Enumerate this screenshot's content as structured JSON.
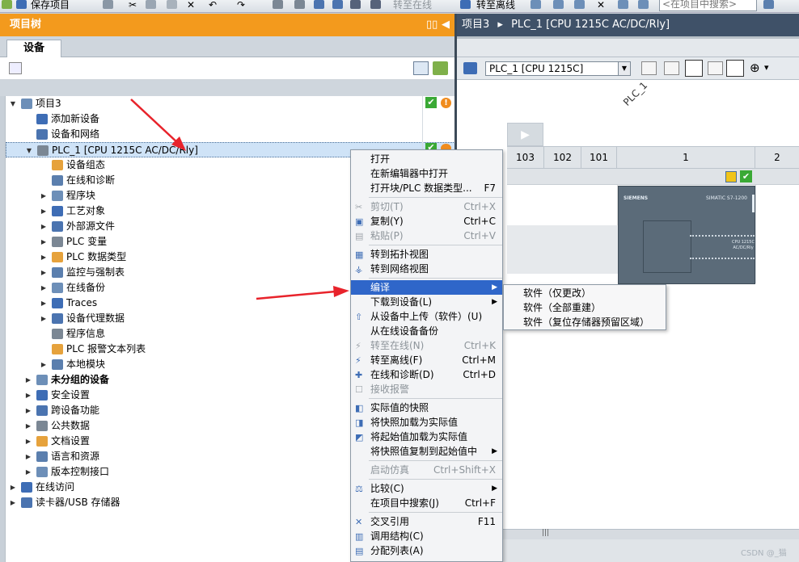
{
  "toolbar": {
    "save_label": "保存项目",
    "go_online_label": "转至在线",
    "go_offline_label": "转至离线",
    "search_placeholder": "<在项目中搜索>"
  },
  "tree_panel": {
    "title": "项目树",
    "devices_tab": "设备"
  },
  "tree": {
    "items": [
      {
        "label": "项目3",
        "level": 0,
        "expanded": true
      },
      {
        "label": "添加新设备",
        "level": 1
      },
      {
        "label": "设备和网络",
        "level": 1
      },
      {
        "label": "PLC_1 [CPU 1215C AC/DC/Rly]",
        "level": 1,
        "expanded": true,
        "selected": true
      },
      {
        "label": "设备组态",
        "level": 2
      },
      {
        "label": "在线和诊断",
        "level": 2
      },
      {
        "label": "程序块",
        "level": 2,
        "collapsed": true
      },
      {
        "label": "工艺对象",
        "level": 2,
        "collapsed": true
      },
      {
        "label": "外部源文件",
        "level": 2,
        "collapsed": true
      },
      {
        "label": "PLC 变量",
        "level": 2,
        "collapsed": true
      },
      {
        "label": "PLC 数据类型",
        "level": 2,
        "collapsed": true
      },
      {
        "label": "监控与强制表",
        "level": 2,
        "collapsed": true
      },
      {
        "label": "在线备份",
        "level": 2,
        "collapsed": true
      },
      {
        "label": "Traces",
        "level": 2,
        "collapsed": true
      },
      {
        "label": "设备代理数据",
        "level": 2,
        "collapsed": true
      },
      {
        "label": "程序信息",
        "level": 2
      },
      {
        "label": "PLC 报警文本列表",
        "level": 2
      },
      {
        "label": "本地模块",
        "level": 2,
        "collapsed": true
      },
      {
        "label": "未分组的设备",
        "level": 1,
        "collapsed": true,
        "bold": true
      },
      {
        "label": "安全设置",
        "level": 1,
        "collapsed": true
      },
      {
        "label": "跨设备功能",
        "level": 1,
        "collapsed": true
      },
      {
        "label": "公共数据",
        "level": 1,
        "collapsed": true
      },
      {
        "label": "文档设置",
        "level": 1,
        "collapsed": true
      },
      {
        "label": "语言和资源",
        "level": 1,
        "collapsed": true
      },
      {
        "label": "版本控制接口",
        "level": 1,
        "collapsed": true
      },
      {
        "label": "在线访问",
        "level": 0,
        "collapsed": true
      },
      {
        "label": "读卡器/USB 存储器",
        "level": 0,
        "collapsed": true
      }
    ]
  },
  "editor": {
    "breadcrumb_project": "项目3",
    "breadcrumb_arrow": "▸",
    "breadcrumb_device": "PLC_1 [CPU 1215C AC/DC/Rly]",
    "device_select": "PLC_1 [CPU 1215C]",
    "station_label": "PLC_1",
    "slots": [
      "103",
      "102",
      "101",
      "1",
      "2"
    ],
    "cpu_brand": "SIEMENS",
    "cpu_model": "SIMATIC S7-1200",
    "cpu_type": "CPU 1215C AC/DC/Rly",
    "scroll_grip": "|||"
  },
  "context_menu": {
    "items": [
      {
        "label": "打开",
        "type": "item"
      },
      {
        "label": "在新编辑器中打开",
        "type": "item"
      },
      {
        "label": "打开块/PLC 数据类型...",
        "shortcut": "F7",
        "type": "item"
      },
      {
        "type": "sep"
      },
      {
        "label": "剪切(T)",
        "shortcut": "Ctrl+X",
        "type": "item",
        "disabled": true,
        "icon": "scissors-icon"
      },
      {
        "label": "复制(Y)",
        "shortcut": "Ctrl+C",
        "type": "item",
        "icon": "copy-icon"
      },
      {
        "label": "粘贴(P)",
        "shortcut": "Ctrl+V",
        "type": "item",
        "disabled": true,
        "icon": "paste-icon"
      },
      {
        "type": "sep"
      },
      {
        "label": "转到拓扑视图",
        "type": "item",
        "icon": "topology-icon"
      },
      {
        "label": "转到网络视图",
        "type": "item",
        "icon": "network-icon"
      },
      {
        "type": "sep"
      },
      {
        "label": "编译",
        "type": "item",
        "submenu": true,
        "highlighted": true
      },
      {
        "label": "下载到设备(L)",
        "type": "item",
        "submenu": true
      },
      {
        "label": "从设备中上传（软件）(U)",
        "type": "item",
        "icon": "upload-icon"
      },
      {
        "label": "从在线设备备份",
        "type": "item"
      },
      {
        "label": "转至在线(N)",
        "shortcut": "Ctrl+K",
        "type": "item",
        "disabled": true,
        "icon": "go-online-icon"
      },
      {
        "label": "转至离线(F)",
        "shortcut": "Ctrl+M",
        "type": "item",
        "icon": "go-offline-icon"
      },
      {
        "label": "在线和诊断(D)",
        "shortcut": "Ctrl+D",
        "type": "item",
        "icon": "diagnostics-icon"
      },
      {
        "label": "接收报警",
        "type": "item",
        "disabled": true,
        "icon": "checkbox-icon"
      },
      {
        "type": "sep"
      },
      {
        "label": "实际值的快照",
        "type": "item",
        "icon": "snapshot-icon"
      },
      {
        "label": "将快照加载为实际值",
        "type": "item",
        "icon": "load-snapshot-icon"
      },
      {
        "label": "将起始值加载为实际值",
        "type": "item",
        "icon": "load-start-icon"
      },
      {
        "label": "将快照值复制到起始值中",
        "type": "item",
        "submenu": true
      },
      {
        "type": "sep"
      },
      {
        "label": "启动仿真",
        "shortcut": "Ctrl+Shift+X",
        "type": "item",
        "disabled": true
      },
      {
        "type": "sep"
      },
      {
        "label": "比较(C)",
        "type": "item",
        "submenu": true,
        "icon": "compare-icon"
      },
      {
        "label": "在项目中搜索(J)",
        "shortcut": "Ctrl+F",
        "type": "item"
      },
      {
        "type": "sep"
      },
      {
        "label": "交叉引用",
        "shortcut": "F11",
        "type": "item",
        "icon": "cross-ref-icon"
      },
      {
        "label": "调用结构(C)",
        "type": "item",
        "icon": "call-structure-icon"
      },
      {
        "label": "分配列表(A)",
        "type": "item",
        "icon": "assignment-icon"
      }
    ]
  },
  "submenu": {
    "items": [
      "软件（仅更改）",
      "软件（全部重建）",
      "软件（复位存储器预留区域）"
    ]
  },
  "watermark": "CSDN @_猫",
  "colors": {
    "tree_header": "#f39a1d",
    "editor_header": "#3f5168",
    "menu_highlight": "#2f66c9",
    "arrow_red": "#e8232b",
    "status_ok": "#3aa935",
    "status_warn": "#f08c1e"
  }
}
